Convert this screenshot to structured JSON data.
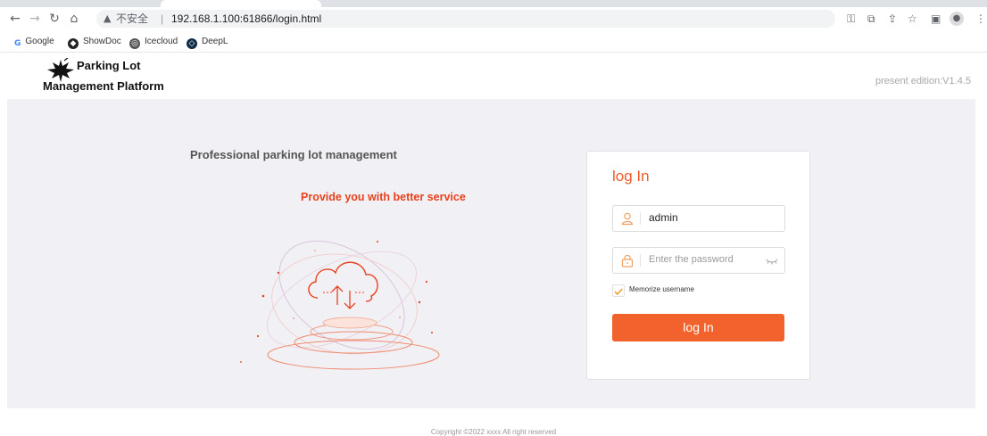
{
  "browser": {
    "security_label": "不安全",
    "url": "192.168.1.100:61866/login.html",
    "bookmarks": [
      {
        "label": "Google",
        "icon": "google-icon",
        "color": "#4285f4"
      },
      {
        "label": "ShowDoc",
        "icon": "showdoc-icon",
        "color": "#222222"
      },
      {
        "label": "Icecloud",
        "icon": "icecloud-icon",
        "color": "#555555"
      },
      {
        "label": "DeepL",
        "icon": "deepl-icon",
        "color": "#0f2b46"
      }
    ]
  },
  "header": {
    "brand_line1": "Parking Lot",
    "brand_line2": "Management Platform",
    "edition": "present edition:V1.4.5"
  },
  "hero": {
    "title": "Professional parking lot management",
    "subtitle": "Provide you with better service"
  },
  "login": {
    "title": "log In",
    "username_value": "admin",
    "password_placeholder": "Enter the password",
    "remember_label": "Memorize username",
    "remember_checked": true,
    "submit_label": "log In",
    "accent": "#f2622c"
  },
  "footer": {
    "copyright": "Copyright ©2022 xxxx All right reserved"
  }
}
